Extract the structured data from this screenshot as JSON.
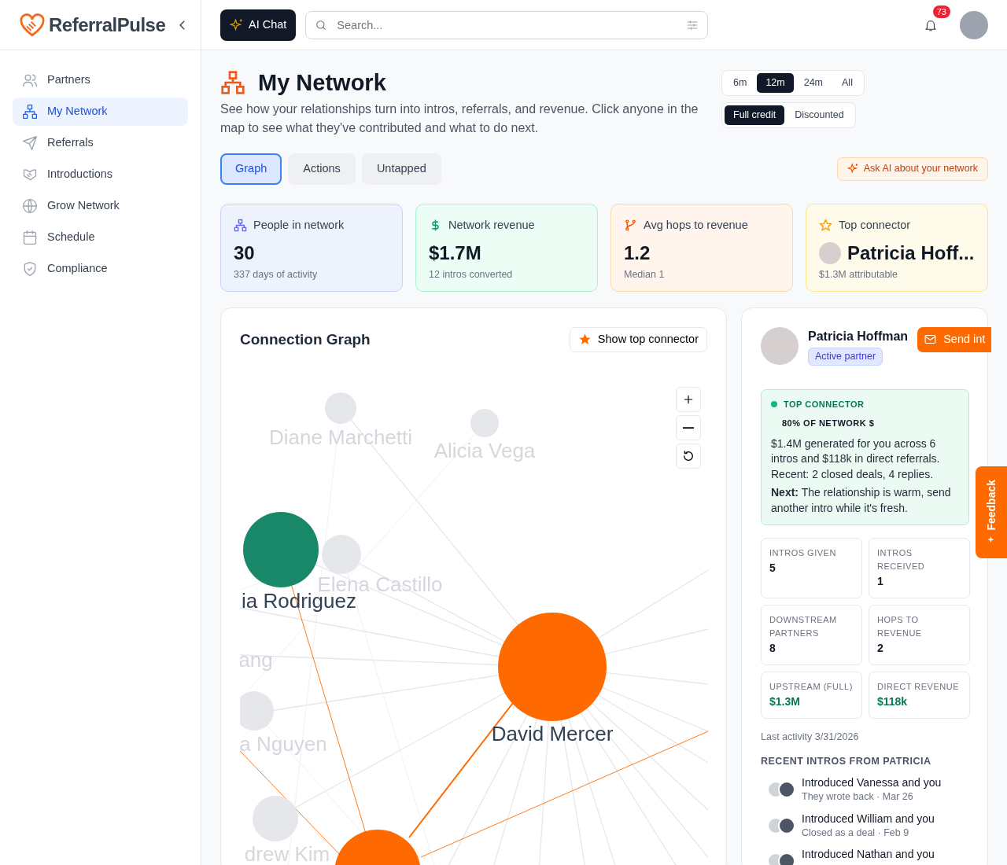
{
  "brand": {
    "name": "ReferralPulse"
  },
  "header": {
    "ai_button": "AI Chat",
    "search": {
      "placeholder": "Search..."
    },
    "notifications": "73"
  },
  "sidebar": {
    "items": [
      {
        "label": "Partners",
        "selected": false
      },
      {
        "label": "My Network",
        "selected": true
      },
      {
        "label": "Referrals",
        "selected": false
      },
      {
        "label": "Introductions",
        "selected": false
      },
      {
        "label": "Grow Network",
        "selected": false
      },
      {
        "label": "Schedule",
        "selected": false
      },
      {
        "label": "Compliance",
        "selected": false
      }
    ]
  },
  "page": {
    "title": "My Network",
    "description": "See how your relationships turn into intros, referrals, and revenue. Click anyone in the map to see what they've contributed and what to do next.",
    "periods": [
      {
        "label": "6m",
        "selected": false
      },
      {
        "label": "12m",
        "selected": true
      },
      {
        "label": "24m",
        "selected": false
      },
      {
        "label": "All",
        "selected": false
      }
    ],
    "credit_modes": [
      {
        "label": "Full credit",
        "selected": true
      },
      {
        "label": "Discounted",
        "selected": false
      }
    ],
    "tabs": [
      {
        "label": "Graph",
        "selected": true
      },
      {
        "label": "Actions",
        "selected": false
      },
      {
        "label": "Untapped",
        "selected": false
      }
    ],
    "ask_ai": "Ask AI about your network"
  },
  "stats": [
    {
      "kind": "people",
      "label": "People in network",
      "value": "30",
      "note": "337 days of activity"
    },
    {
      "kind": "revenue",
      "label": "Network revenue",
      "value": "$1.7M",
      "note": "12 intros converted"
    },
    {
      "kind": "hops",
      "label": "Avg hops to revenue",
      "value": "1.2",
      "note": "Median 1"
    },
    {
      "kind": "connector",
      "label": "Top connector",
      "value": "Patricia Hoff...",
      "note": "$1.3M attributable"
    }
  ],
  "graph": {
    "title": "Connection Graph",
    "show_top": "Show top connector",
    "nodes": [
      {
        "label": "Diane Marchetti",
        "color": "#e5e7eb",
        "highlighted": false
      },
      {
        "label": "Alicia Vega",
        "color": "#e5e7eb",
        "highlighted": false
      },
      {
        "label": "Elena Castillo",
        "color": "#e5e7eb",
        "highlighted": false
      },
      {
        "label": "ia Rodriguez",
        "color": "#188868",
        "highlighted": true
      },
      {
        "label": "ang",
        "highlighted": false
      },
      {
        "label": "a Nguyen",
        "color": "#e5e7eb",
        "highlighted": false
      },
      {
        "label": "David Mercer",
        "color": "#ff6a00",
        "highlighted": true
      },
      {
        "label": "drew Kim",
        "color": "#e5e7eb",
        "highlighted": false
      },
      {
        "color": "#ff6a00"
      }
    ]
  },
  "profile": {
    "name": "Patricia Hoffman",
    "status": "Active partner",
    "send": "Send int",
    "insight": {
      "tag": "TOP CONNECTOR",
      "share": "80% OF NETWORK $",
      "body": "$1.4M generated for you across 6 intros and $118k in direct referrals. Recent: 2 closed deals, 4 replies.",
      "next": "**Next:** The relationship is warm, send another intro while it's fresh."
    },
    "metrics": [
      {
        "label": "INTROS GIVEN",
        "value": "5",
        "kind": "count"
      },
      {
        "label": "INTROS RECEIVED",
        "value": "1",
        "kind": "count"
      },
      {
        "label": "DOWNSTREAM PARTNERS",
        "value": "8",
        "kind": "count"
      },
      {
        "label": "HOPS TO REVENUE",
        "value": "2",
        "kind": "count"
      },
      {
        "label": "UPSTREAM (FULL)",
        "value": "$1.3M",
        "kind": "money"
      },
      {
        "label": "DIRECT REVENUE",
        "value": "$118k",
        "kind": "money"
      }
    ],
    "last_activity": "Last activity 3/31/2026",
    "recent_title": "RECENT INTROS FROM PATRICIA",
    "recent": [
      {
        "title": "Introduced Vanessa and you",
        "meta": "They wrote back · Mar 26"
      },
      {
        "title": "Introduced William and you",
        "meta": "Closed as a deal · Feb 9"
      },
      {
        "title": "Introduced Nathan and you"
      }
    ]
  },
  "feedback": "Feedback"
}
